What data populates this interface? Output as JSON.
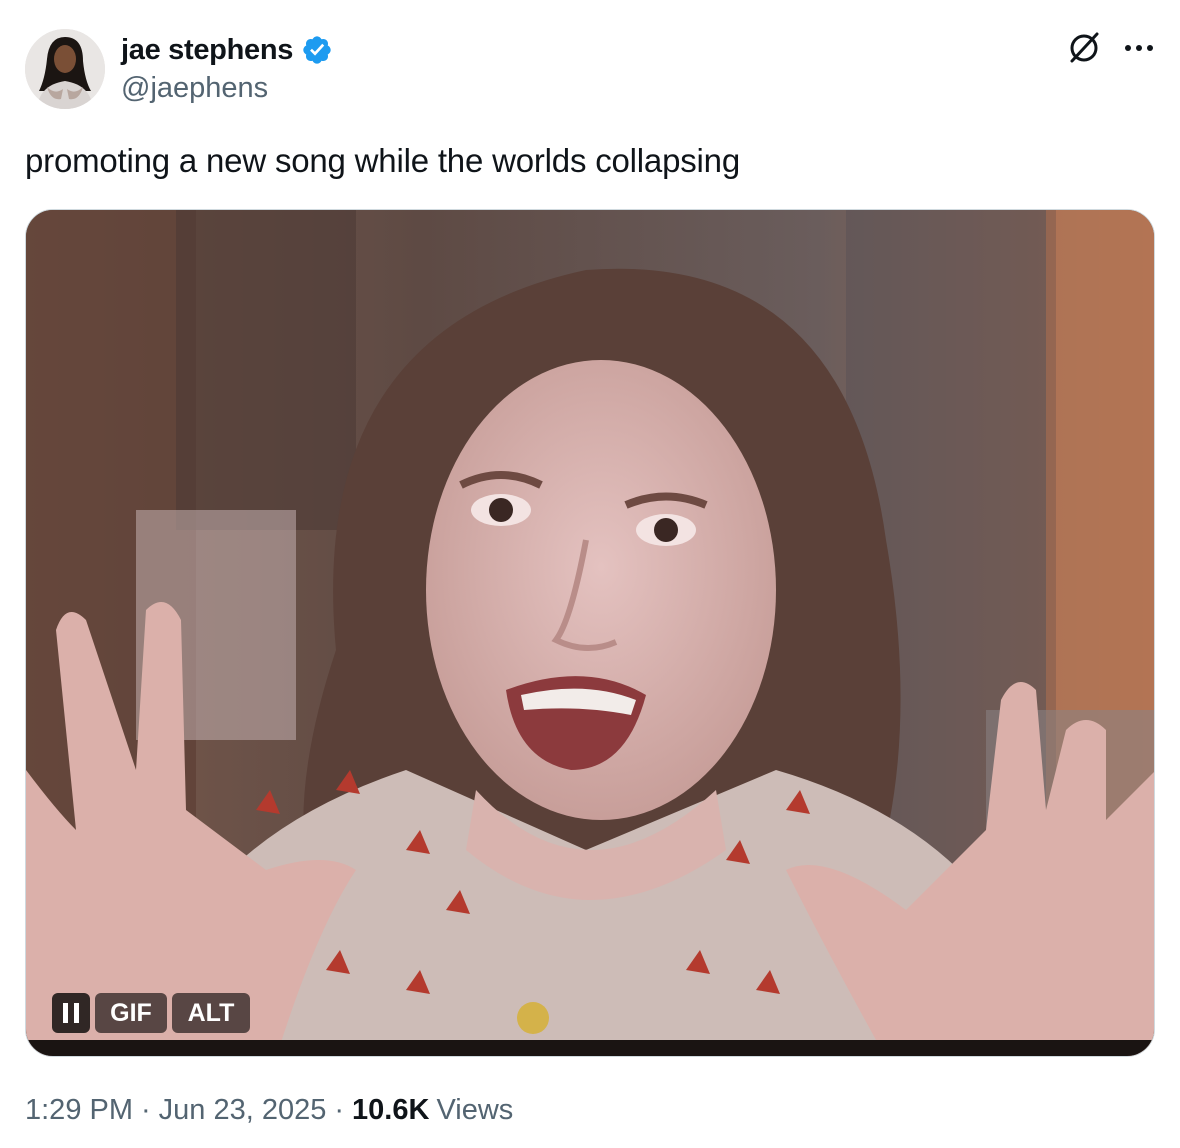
{
  "author": {
    "name": "jae stephens",
    "handle": "@jaephens",
    "verified": true,
    "badge_color": "#1d9bf0"
  },
  "tweet": {
    "text": "promoting a new song while the worlds collapsing"
  },
  "media": {
    "type": "GIF",
    "gif_label": "GIF",
    "alt_label": "ALT",
    "state": "playing"
  },
  "meta": {
    "time": "1:29 PM",
    "separator": "·",
    "date": "Jun 23, 2025",
    "views_count": "10.6K",
    "views_label": "Views"
  },
  "icons": {
    "grok": "grok-icon",
    "more": "more-options-icon",
    "pause": "pause-icon",
    "verified": "verified-badge-icon"
  }
}
